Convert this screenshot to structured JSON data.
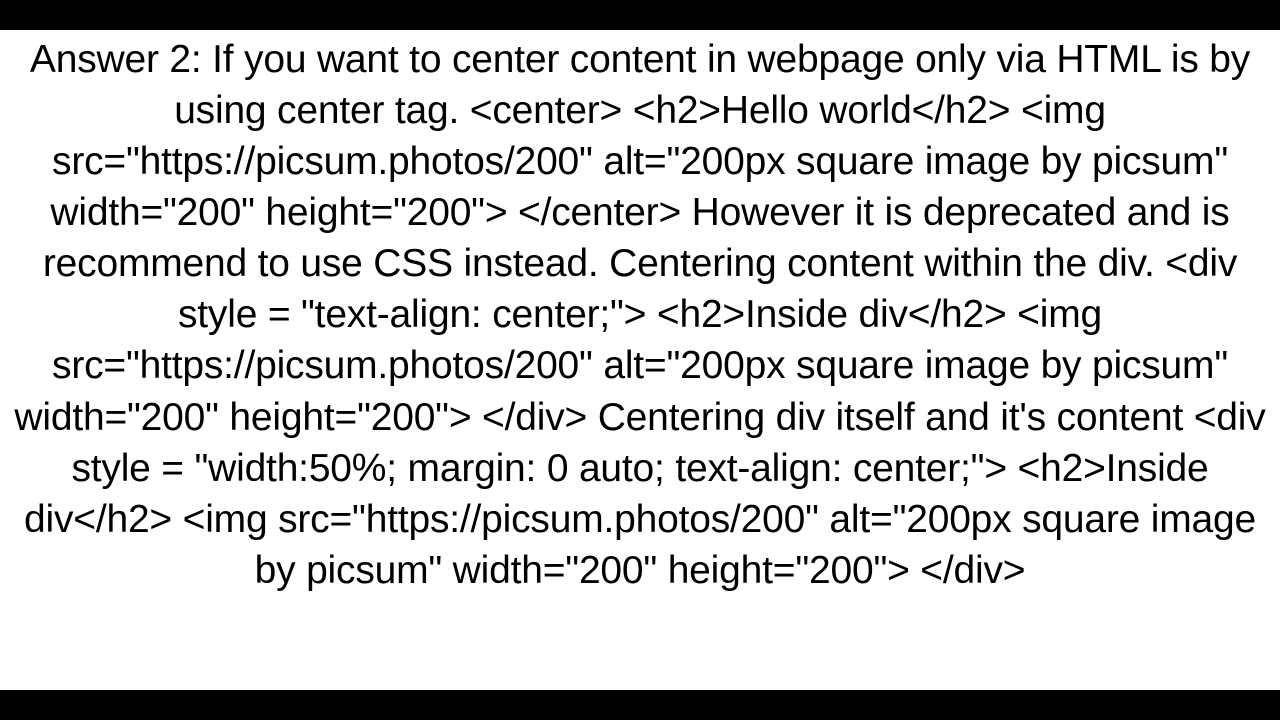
{
  "answer": {
    "text": "Answer 2: If you want to center content in webpage only via HTML is by using center tag. <center> <h2>Hello world</h2> <img src=\"https://picsum.photos/200\" alt=\"200px square image by picsum\" width=\"200\" height=\"200\"> </center>  However it is deprecated and is recommend to use CSS instead. Centering content within the div. <div style = \"text-align: center;\">    <h2>Inside div</h2>    <img src=\"https://picsum.photos/200\" alt=\"200px square image by picsum\" width=\"200\" height=\"200\"> </div>   Centering div itself and it's content   <div style = \"width:50%; margin: 0 auto; text-align: center;\">     <h2>Inside div</h2>     <img src=\"https://picsum.photos/200\" alt=\"200px square image by picsum\" width=\"200\" height=\"200\"> </div>"
  }
}
